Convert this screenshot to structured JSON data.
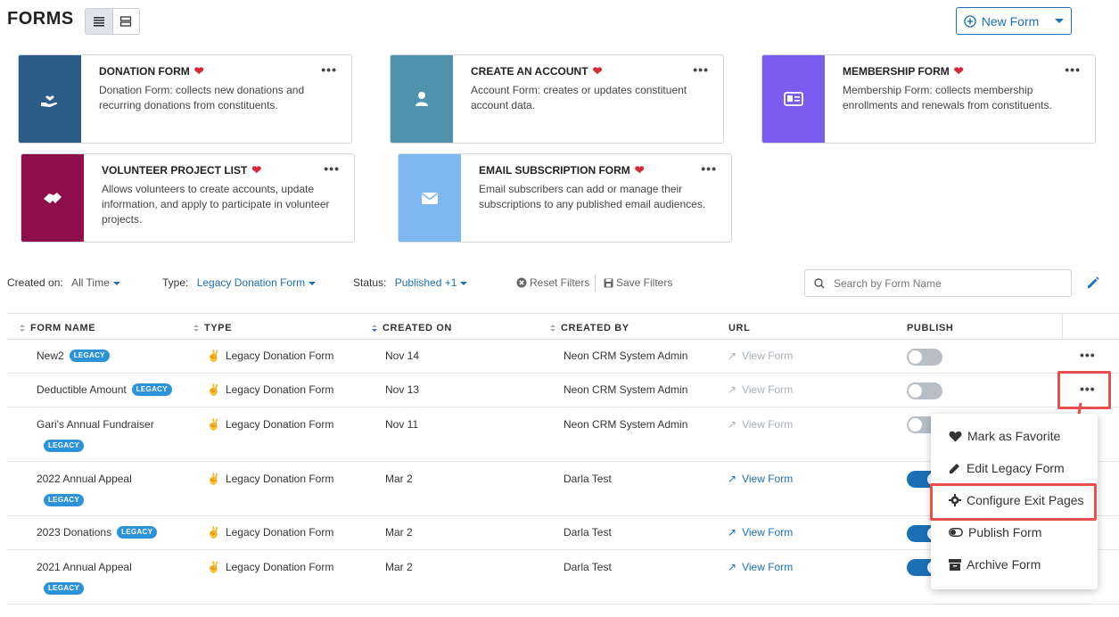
{
  "header": {
    "title": "FORMS",
    "new_form_label": "New Form"
  },
  "cards": [
    {
      "title": "DONATION FORM",
      "desc": "Donation Form: collects new donations and recurring donations from constituents.",
      "color": "#2b5d86",
      "icon": "hand-heart-icon"
    },
    {
      "title": "CREATE AN ACCOUNT",
      "desc": "Account Form: creates or updates constituent account data.",
      "color": "#4f92ab",
      "icon": "user-icon"
    },
    {
      "title": "MEMBERSHIP FORM",
      "desc": "Membership Form: collects membership enrollments and renewals from constituents.",
      "color": "#7a5cf0",
      "icon": "id-card-icon"
    },
    {
      "title": "VOLUNTEER PROJECT LIST",
      "desc": "Allows volunteers to create accounts, update information, and apply to participate in volunteer projects.",
      "color": "#8e0d4b",
      "icon": "handshake-icon"
    },
    {
      "title": "EMAIL SUBSCRIPTION FORM",
      "desc": "Email subscribers can add or manage their subscriptions to any published email audiences.",
      "color": "#7db9f0",
      "icon": "envelope-icon"
    }
  ],
  "filters": {
    "created_label": "Created on:",
    "created_value": "All Time",
    "type_label": "Type:",
    "type_value": "Legacy Donation Form",
    "status_label": "Status:",
    "status_value": "Published +1",
    "reset_label": "Reset Filters",
    "save_label": "Save Filters",
    "search_placeholder": "Search by Form Name"
  },
  "table": {
    "columns": [
      "FORM NAME",
      "TYPE",
      "CREATED ON",
      "CREATED BY",
      "URL",
      "PUBLISH"
    ],
    "badge_label": "LEGACY",
    "rows": [
      {
        "name": "New2",
        "type": "Legacy Donation Form",
        "created_on": "Nov 14",
        "created_by": "Neon CRM System Admin",
        "url": "View Form",
        "url_enabled": false,
        "published": false
      },
      {
        "name": "Deductible Amount",
        "type": "Legacy Donation Form",
        "created_on": "Nov 13",
        "created_by": "Neon CRM System Admin",
        "url": "View Form",
        "url_enabled": false,
        "published": false
      },
      {
        "name": "Gari's Annual Fundraiser",
        "type": "Legacy Donation Form",
        "created_on": "Nov 11",
        "created_by": "Neon CRM System Admin",
        "url": "View Form",
        "url_enabled": false,
        "published": false
      },
      {
        "name": "2022 Annual Appeal",
        "type": "Legacy Donation Form",
        "created_on": "Mar 2",
        "created_by": "Darla Test",
        "url": "View Form",
        "url_enabled": true,
        "published": true
      },
      {
        "name": "2023 Donations",
        "type": "Legacy Donation Form",
        "created_on": "Mar 2",
        "created_by": "Darla Test",
        "url": "View Form",
        "url_enabled": true,
        "published": true
      },
      {
        "name": "2021 Annual Appeal",
        "type": "Legacy Donation Form",
        "created_on": "Mar 2",
        "created_by": "Darla Test",
        "url": "View Form",
        "url_enabled": true,
        "published": true
      }
    ]
  },
  "context_menu": {
    "items": [
      {
        "label": "Mark as Favorite",
        "icon": "heart-icon"
      },
      {
        "label": "Edit Legacy Form",
        "icon": "pencil-icon"
      },
      {
        "label": "Configure Exit Pages",
        "icon": "gear-icon"
      },
      {
        "label": "Publish Form",
        "icon": "toggle-icon"
      },
      {
        "label": "Archive Form",
        "icon": "archive-icon"
      }
    ]
  },
  "colors": {
    "accent": "#1b6fb5",
    "heart": "#d62839",
    "annotation": "#e8504d"
  }
}
